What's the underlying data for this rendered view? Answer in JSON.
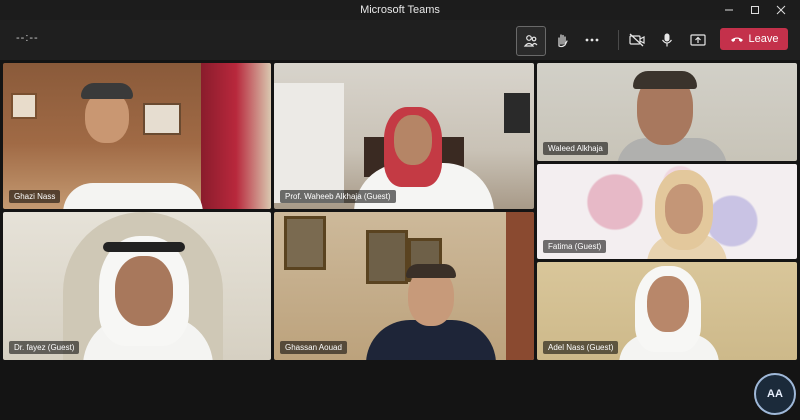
{
  "window": {
    "title": "Microsoft Teams"
  },
  "toolbar": {
    "timer": "--:--",
    "leave_label": "Leave"
  },
  "participants": [
    {
      "name": "Ghazi Nass"
    },
    {
      "name": "Prof. Waheeb Alkhaja (Guest)"
    },
    {
      "name": "Waleed Alkhaja"
    },
    {
      "name": "Fatima (Guest)"
    },
    {
      "name": "Dr. fayez (Guest)"
    },
    {
      "name": "Ghassan Aouad"
    },
    {
      "name": "Adel Nass (Guest)"
    }
  ],
  "me": {
    "initials": "AA"
  },
  "colors": {
    "leave": "#c4314b",
    "accent": "#9fb8d8"
  }
}
